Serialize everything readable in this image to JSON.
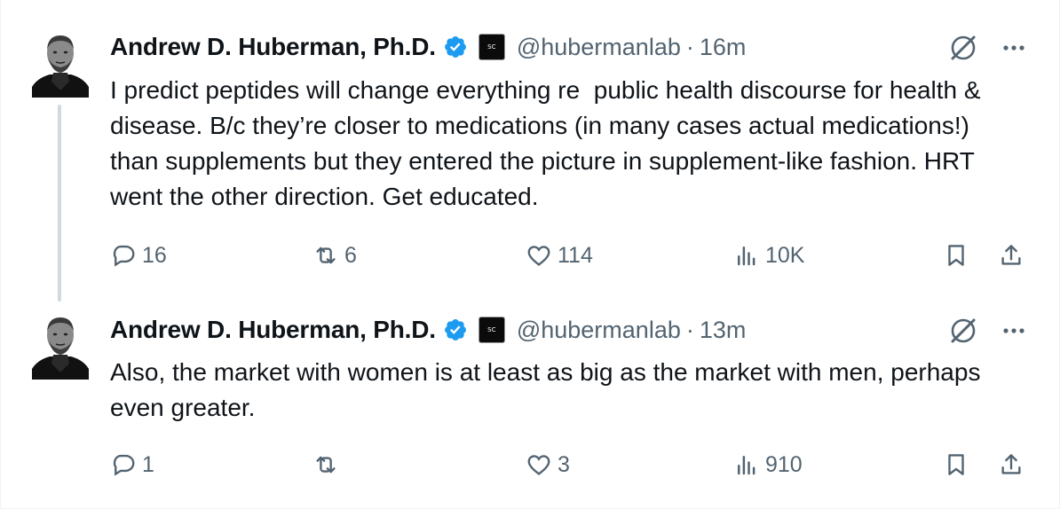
{
  "tweets": [
    {
      "author_name": "Andrew D. Huberman, Ph.D.",
      "handle": "@hubermanlab",
      "separator": "·",
      "time": "16m",
      "affiliation_badge_text": "SC",
      "text": "I predict peptides will change everything re  public health discourse for health & disease. B/c they’re closer to medications (in many cases actual medications!) than supplements but they entered the picture in supplement-like fashion. HRT went the other direction. Get educated.",
      "stats": {
        "replies": "16",
        "reposts": "6",
        "likes": "114",
        "views": "10K"
      }
    },
    {
      "author_name": "Andrew D. Huberman, Ph.D.",
      "handle": "@hubermanlab",
      "separator": "·",
      "time": "13m",
      "affiliation_badge_text": "SC",
      "text": "Also, the market with women is at least as big as the market with men, perhaps even greater.",
      "stats": {
        "replies": "1",
        "reposts": "",
        "likes": "3",
        "views": "910"
      }
    }
  ],
  "icons": {
    "verified": "verified-badge-icon",
    "grok": "grok-icon",
    "more": "more-icon",
    "reply": "reply-icon",
    "repost": "repost-icon",
    "like": "like-icon",
    "views": "views-icon",
    "bookmark": "bookmark-icon",
    "share": "share-icon"
  },
  "colors": {
    "text": "#0f1419",
    "secondary": "#536471",
    "verified": "#1d9bf0",
    "thread_line": "#cfd9de"
  }
}
